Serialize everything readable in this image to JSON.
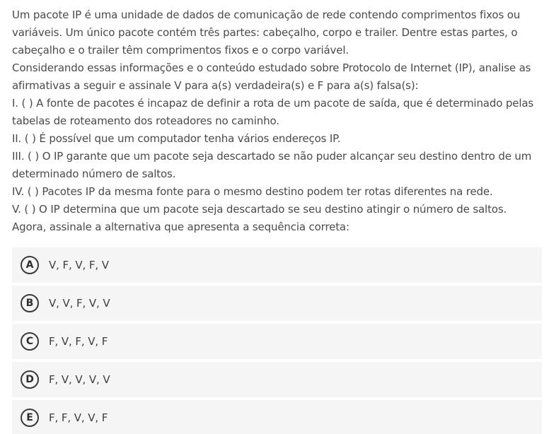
{
  "question": {
    "paragraphs": [
      "Um pacote IP é uma unidade de dados de comunicação de rede contendo comprimentos fixos ou variáveis. Um único pacote contém três partes: cabeçalho, corpo e trailer. Dentre estas partes, o cabeçalho e o trailer têm comprimentos fixos e o corpo variável.",
      "Considerando essas informações e o conteúdo estudado sobre Protocolo de Internet (IP), analise as afirmativas a seguir e assinale V para a(s) verdadeira(s) e F para a(s) falsa(s):",
      "I. ( ) A fonte de pacotes é incapaz de definir a rota de um pacote de saída, que é determinado pelas tabelas de roteamento dos roteadores no caminho.",
      "II. ( ) É possível que um computador tenha vários endereços IP.",
      "III. ( ) O IP garante que um pacote seja descartado se não puder alcançar seu destino dentro de um determinado número de saltos.",
      "IV. ( ) Pacotes IP da mesma fonte para o mesmo destino podem ter rotas diferentes na rede.",
      "V. ( ) O IP determina que um pacote seja descartado se seu destino atingir o número de saltos.",
      "Agora, assinale a alternativa que apresenta a sequência correta:"
    ]
  },
  "options": [
    {
      "letter": "A",
      "text": "V, F, V, F, V"
    },
    {
      "letter": "B",
      "text": "V, V, F, V, V"
    },
    {
      "letter": "C",
      "text": "F, V, F, V, F"
    },
    {
      "letter": "D",
      "text": "F, V, V, V, V"
    },
    {
      "letter": "E",
      "text": "F, F, V, V, F"
    }
  ],
  "colors": {
    "text": "#4a4a4a",
    "option_background": "#f5f5f5",
    "badge_border": "#3a3a3a"
  }
}
